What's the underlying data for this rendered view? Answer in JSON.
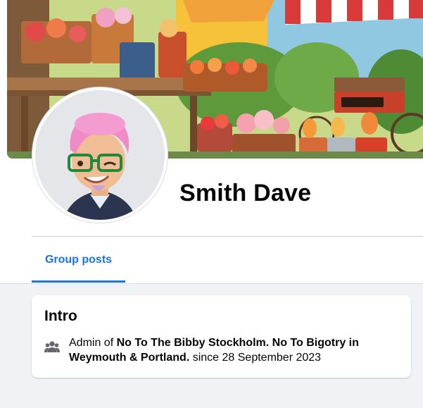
{
  "profile": {
    "name": "Smith Dave",
    "cover_alt": "flower-market-cover-photo",
    "avatar_alt": "avatar-image"
  },
  "tabs": [
    {
      "label": "Group posts",
      "active": true
    }
  ],
  "intro": {
    "title": "Intro",
    "icon": "group-members-icon",
    "prefix": "Admin of ",
    "group_name": "No To The Bibby Stockholm. No To Bigotry in Weymouth & Portland.",
    "suffix": " since 28 September 2023"
  },
  "colors": {
    "accent": "#1b74e4",
    "background": "#f0f2f5",
    "card": "#ffffff",
    "text": "#050505",
    "icon": "#65676b"
  }
}
